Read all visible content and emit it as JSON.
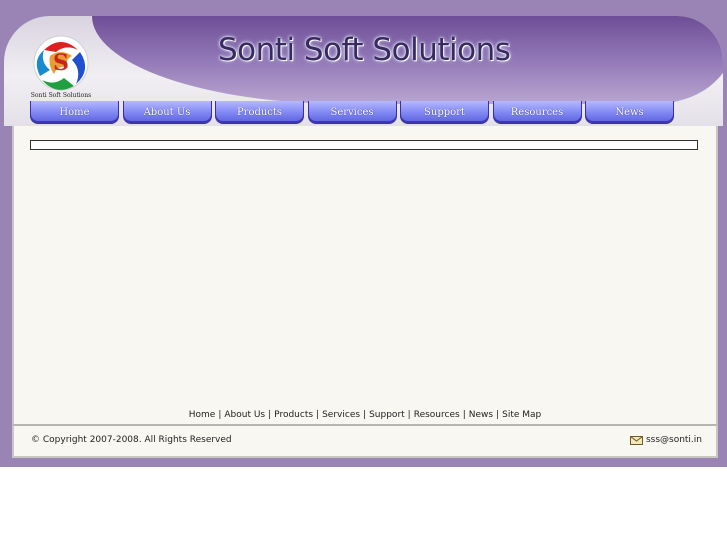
{
  "header": {
    "site_title": "Sonti Soft Solutions",
    "logo_caption": "Sonti Soft Solutions"
  },
  "nav": {
    "items": [
      {
        "label": "Home"
      },
      {
        "label": "About Us"
      },
      {
        "label": "Products"
      },
      {
        "label": "Services"
      },
      {
        "label": "Support"
      },
      {
        "label": "Resources"
      },
      {
        "label": "News"
      }
    ]
  },
  "footer": {
    "links": [
      {
        "label": "Home"
      },
      {
        "label": "About Us"
      },
      {
        "label": "Products"
      },
      {
        "label": "Services"
      },
      {
        "label": "Support"
      },
      {
        "label": "Resources"
      },
      {
        "label": "News"
      },
      {
        "label": "Site Map"
      }
    ],
    "separator": "|",
    "copyright": "© Copyright 2007-2008. All Rights Reserved",
    "email": "sss@sonti.in"
  },
  "colors": {
    "page_frame": "#9a84b6",
    "header_swoosh": "#6e4e96",
    "nav_tab": "#7f86f2",
    "panel_bg": "#f8f7f2"
  }
}
